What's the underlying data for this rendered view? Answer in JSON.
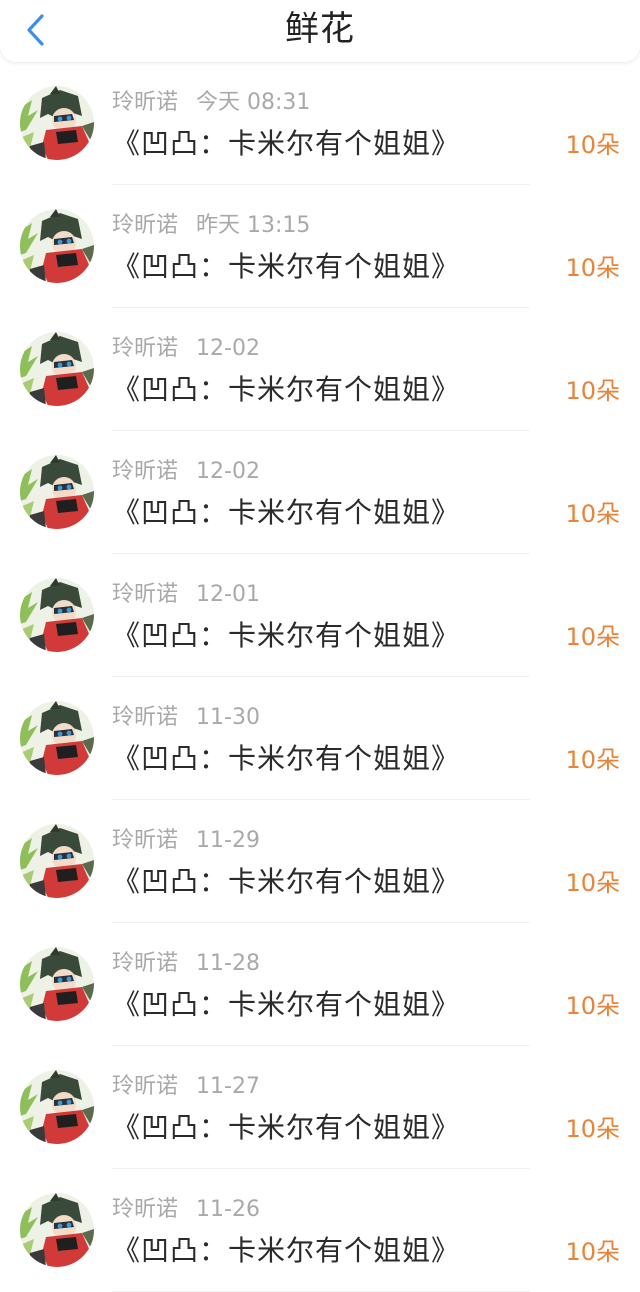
{
  "header": {
    "title": "鲜花",
    "back_icon": "chevron-left-icon",
    "accent": "#3d8ee8"
  },
  "colors": {
    "count": "#e8843a",
    "meta": "#a9a9a9",
    "title": "#2b2b2b"
  },
  "records": [
    {
      "name": "玲昕诺",
      "time": "今天 08:31",
      "title": "《凹凸：卡米尔有个姐姐》",
      "count": "10朵"
    },
    {
      "name": "玲昕诺",
      "time": "昨天 13:15",
      "title": "《凹凸：卡米尔有个姐姐》",
      "count": "10朵"
    },
    {
      "name": "玲昕诺",
      "time": "12-02",
      "title": "《凹凸：卡米尔有个姐姐》",
      "count": "10朵"
    },
    {
      "name": "玲昕诺",
      "time": "12-02",
      "title": "《凹凸：卡米尔有个姐姐》",
      "count": "10朵"
    },
    {
      "name": "玲昕诺",
      "time": "12-01",
      "title": "《凹凸：卡米尔有个姐姐》",
      "count": "10朵"
    },
    {
      "name": "玲昕诺",
      "time": "11-30",
      "title": "《凹凸：卡米尔有个姐姐》",
      "count": "10朵"
    },
    {
      "name": "玲昕诺",
      "time": "11-29",
      "title": "《凹凸：卡米尔有个姐姐》",
      "count": "10朵"
    },
    {
      "name": "玲昕诺",
      "time": "11-28",
      "title": "《凹凸：卡米尔有个姐姐》",
      "count": "10朵"
    },
    {
      "name": "玲昕诺",
      "time": "11-27",
      "title": "《凹凸：卡米尔有个姐姐》",
      "count": "10朵"
    },
    {
      "name": "玲昕诺",
      "time": "11-26",
      "title": "《凹凸：卡米尔有个姐姐》",
      "count": "10朵"
    }
  ]
}
